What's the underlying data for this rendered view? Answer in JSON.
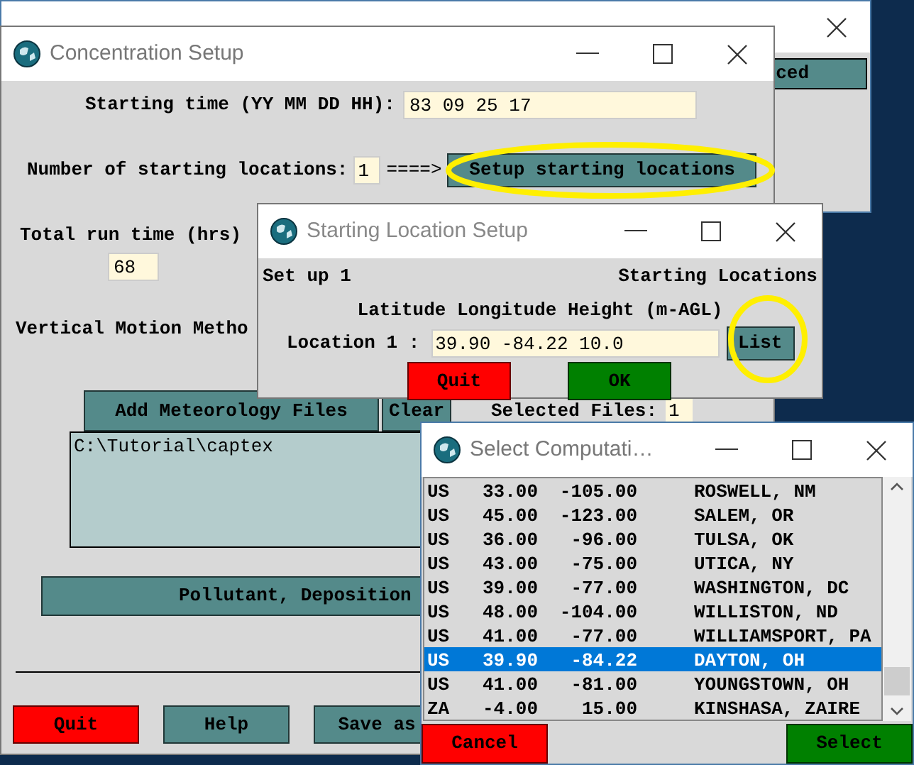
{
  "background_window": {
    "button_label": "ced"
  },
  "concentration_window": {
    "title": "Concentration Setup",
    "starting_time_label": "Starting time (YY MM DD HH):",
    "starting_time": "83 09 25 17",
    "num_locations_label": "Number of starting locations:",
    "num_locations": "1",
    "arrow": "====>",
    "setup_button": "Setup starting locations",
    "run_time_label": "Total run time (hrs)",
    "run_time": "68",
    "vertical_motion_label": "Vertical Motion Metho",
    "add_met_button": "Add Meteorology Files",
    "clear_button": "Clear",
    "selected_files_label": "Selected Files:",
    "selected_files": "1",
    "met_files": [
      "C:\\Tutorial\\captex"
    ],
    "pollutant_button": "Pollutant, Deposition",
    "buttons": [
      {
        "label": "Quit",
        "kind": "danger"
      },
      {
        "label": "Help",
        "kind": "normal"
      },
      {
        "label": "Save as",
        "kind": "normal"
      }
    ]
  },
  "location_window": {
    "title": "Starting Location Setup",
    "setup_label": "Set up 1",
    "heading": "Starting Locations",
    "columns_label": "Latitude Longitude Height (m-AGL)",
    "location_label": "Location 1 :",
    "location_value": "39.90 -84.22 10.0",
    "list_button": "List",
    "buttons": [
      {
        "label": "Quit",
        "kind": "danger"
      },
      {
        "label": "OK",
        "kind": "confirm"
      }
    ]
  },
  "select_window": {
    "title": "Select Computati…",
    "rows": [
      {
        "country": "US",
        "lat": "33.00",
        "lon": "-105.00",
        "place": "ROSWELL, NM",
        "selected": false
      },
      {
        "country": "US",
        "lat": "45.00",
        "lon": "-123.00",
        "place": "SALEM, OR",
        "selected": false
      },
      {
        "country": "US",
        "lat": "36.00",
        "lon": "-96.00",
        "place": "TULSA, OK",
        "selected": false
      },
      {
        "country": "US",
        "lat": "43.00",
        "lon": "-75.00",
        "place": "UTICA, NY",
        "selected": false
      },
      {
        "country": "US",
        "lat": "39.00",
        "lon": "-77.00",
        "place": "WASHINGTON, DC",
        "selected": false
      },
      {
        "country": "US",
        "lat": "48.00",
        "lon": "-104.00",
        "place": "WILLISTON, ND",
        "selected": false
      },
      {
        "country": "US",
        "lat": "41.00",
        "lon": "-77.00",
        "place": "WILLIAMSPORT, PA",
        "selected": false
      },
      {
        "country": "US",
        "lat": "39.90",
        "lon": "-84.22",
        "place": "DAYTON, OH",
        "selected": true
      },
      {
        "country": "US",
        "lat": "41.00",
        "lon": "-81.00",
        "place": "YOUNGSTOWN, OH",
        "selected": false
      },
      {
        "country": "ZA",
        "lat": "-4.00",
        "lon": "15.00",
        "place": "KINSHASA, ZAIRE",
        "selected": false
      }
    ],
    "buttons": [
      {
        "label": "Cancel",
        "kind": "danger"
      },
      {
        "label": "Select",
        "kind": "confirm"
      }
    ]
  }
}
